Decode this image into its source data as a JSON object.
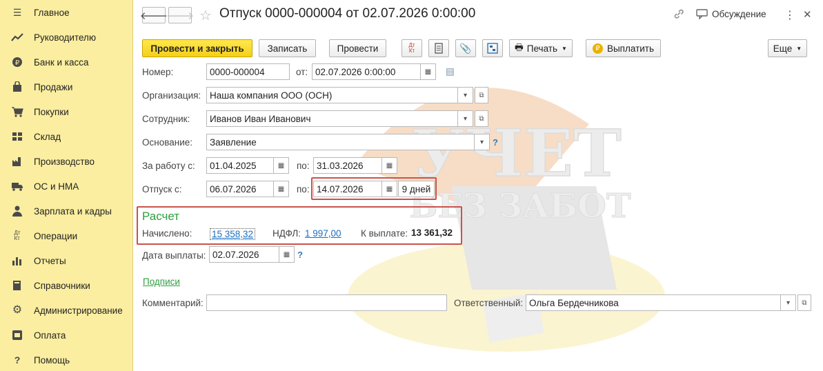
{
  "sidebar": {
    "items": [
      {
        "label": "Главное",
        "icon": "menu-icon"
      },
      {
        "label": "Руководителю",
        "icon": "trend-icon"
      },
      {
        "label": "Банк и касса",
        "icon": "coin-icon"
      },
      {
        "label": "Продажи",
        "icon": "bag-icon"
      },
      {
        "label": "Покупки",
        "icon": "cart-icon"
      },
      {
        "label": "Склад",
        "icon": "warehouse-icon"
      },
      {
        "label": "Производство",
        "icon": "factory-icon"
      },
      {
        "label": "ОС и НМА",
        "icon": "truck-icon"
      },
      {
        "label": "Зарплата и кадры",
        "icon": "person-icon"
      },
      {
        "label": "Операции",
        "icon": "dt-kt-icon"
      },
      {
        "label": "Отчеты",
        "icon": "bar-chart-icon"
      },
      {
        "label": "Справочники",
        "icon": "book-icon"
      },
      {
        "label": "Администрирование",
        "icon": "gear-icon"
      },
      {
        "label": "Оплата",
        "icon": "payment-icon"
      },
      {
        "label": "Помощь",
        "icon": "question-icon"
      }
    ]
  },
  "header": {
    "title": "Отпуск 0000-000004 от 02.07.2026 0:00:00",
    "discussion_label": "Обсуждение"
  },
  "toolbar": {
    "post_close_label": "Провести и закрыть",
    "save_label": "Записать",
    "post_label": "Провести",
    "print_label": "Печать",
    "pay_label": "Выплатить",
    "more_label": "Еще",
    "dt_kt_label": "Дт\nКт"
  },
  "form": {
    "number_label": "Номер:",
    "number_value": "0000-000004",
    "date_label": "от:",
    "date_value": "02.07.2026  0:00:00",
    "org_label": "Организация:",
    "org_value": "Наша компания ООО (ОСН)",
    "employee_label": "Сотрудник:",
    "employee_value": "Иванов Иван Иванович",
    "basis_label": "Основание:",
    "basis_value": "Заявление",
    "work_from_label": "За работу с:",
    "work_from_value": "01.04.2025",
    "work_to_label": "по:",
    "work_to_value": "31.03.2026",
    "vacation_from_label": "Отпуск с:",
    "vacation_from_value": "06.07.2026",
    "vacation_to_label": "по:",
    "vacation_to_value": "14.07.2026",
    "days_value": "9 дней",
    "help_mark": "?"
  },
  "calc": {
    "title": "Расчет",
    "accrued_label": "Начислено:",
    "accrued_value": "15 358,32",
    "ndfl_label": "НДФЛ:",
    "ndfl_value": "1 997,00",
    "payout_label": "К выплате:",
    "payout_value": "13 361,32"
  },
  "payment": {
    "date_label": "Дата выплаты:",
    "date_value": "02.07.2026"
  },
  "footer": {
    "signatures_link": "Подписи",
    "comment_label": "Комментарий:",
    "comment_value": "",
    "responsible_label": "Ответственный:",
    "responsible_value": "Ольга Бердечникова"
  },
  "watermark": {
    "line1": "УЧЕТ",
    "line2": "БЕЗ ЗАБОТ"
  },
  "colors": {
    "sidebar_bg": "#fbeea0",
    "primary_button": "#f5cf18",
    "section_title": "#2e9e3e",
    "highlight_border": "#c9524b",
    "link": "#1a6fbf"
  }
}
